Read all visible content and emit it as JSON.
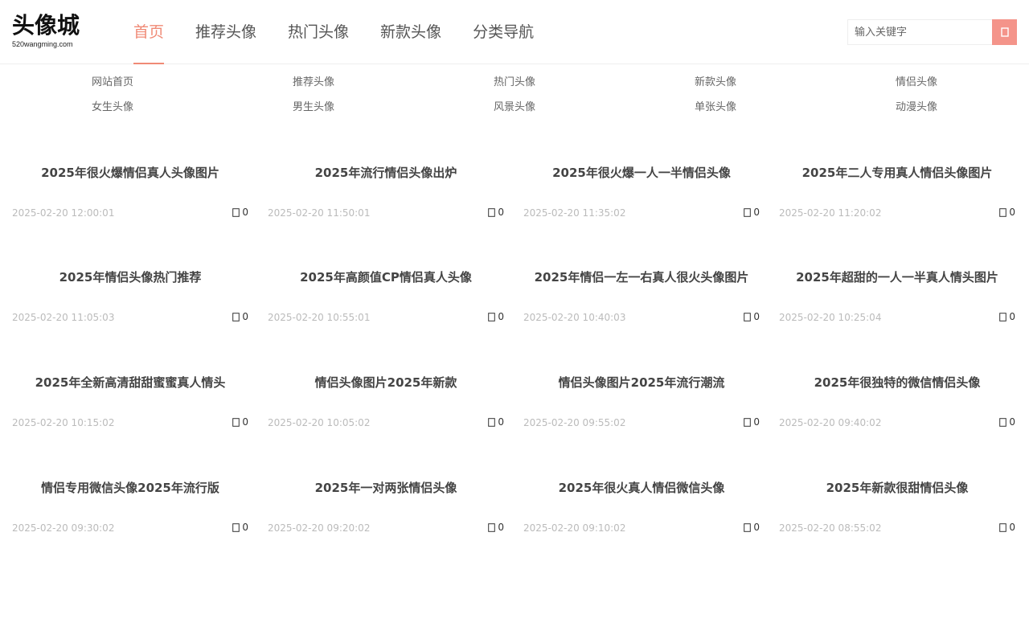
{
  "site": {
    "logo_title": "头像城",
    "logo_sub": "520wangming.com"
  },
  "nav": {
    "items": [
      {
        "label": "首页",
        "active": true
      },
      {
        "label": "推荐头像",
        "active": false
      },
      {
        "label": "热门头像",
        "active": false
      },
      {
        "label": "新款头像",
        "active": false
      },
      {
        "label": "分类导航",
        "active": false
      }
    ]
  },
  "search": {
    "placeholder": "输入关键字",
    "button_icon": "search-icon",
    "button_color": "#f4948a"
  },
  "subnav": {
    "rows": [
      [
        "网站首页",
        "推荐头像",
        "热门头像",
        "新款头像",
        "情侣头像"
      ],
      [
        "女生头像",
        "男生头像",
        "风景头像",
        "单张头像",
        "动漫头像"
      ]
    ]
  },
  "articles": [
    {
      "title": "2025年很火爆情侣真人头像图片",
      "date": "2025-02-20 12:00:01",
      "comments": "0"
    },
    {
      "title": "2025年流行情侣头像出炉",
      "date": "2025-02-20 11:50:01",
      "comments": "0"
    },
    {
      "title": "2025年很火爆一人一半情侣头像",
      "date": "2025-02-20 11:35:02",
      "comments": "0"
    },
    {
      "title": "2025年二人专用真人情侣头像图片",
      "date": "2025-02-20 11:20:02",
      "comments": "0"
    },
    {
      "title": "2025年情侣头像热门推荐",
      "date": "2025-02-20 11:05:03",
      "comments": "0"
    },
    {
      "title": "2025年高颜值CP情侣真人头像",
      "date": "2025-02-20 10:55:01",
      "comments": "0"
    },
    {
      "title": "2025年情侣一左一右真人很火头像图片",
      "date": "2025-02-20 10:40:03",
      "comments": "0"
    },
    {
      "title": "2025年超甜的一人一半真人情头图片",
      "date": "2025-02-20 10:25:04",
      "comments": "0"
    },
    {
      "title": "2025年全新高清甜甜蜜蜜真人情头",
      "date": "2025-02-20 10:15:02",
      "comments": "0"
    },
    {
      "title": "情侣头像图片2025年新款",
      "date": "2025-02-20 10:05:02",
      "comments": "0"
    },
    {
      "title": "情侣头像图片2025年流行潮流",
      "date": "2025-02-20 09:55:02",
      "comments": "0"
    },
    {
      "title": "2025年很独特的微信情侣头像",
      "date": "2025-02-20 09:40:02",
      "comments": "0"
    },
    {
      "title": "情侣专用微信头像2025年流行版",
      "date": "2025-02-20 09:30:02",
      "comments": "0"
    },
    {
      "title": "2025年一对两张情侣头像",
      "date": "2025-02-20 09:20:02",
      "comments": "0"
    },
    {
      "title": "2025年很火真人情侣微信头像",
      "date": "2025-02-20 09:10:02",
      "comments": "0"
    },
    {
      "title": "2025年新款很甜情侣头像",
      "date": "2025-02-20 08:55:02",
      "comments": "0"
    }
  ],
  "colors": {
    "accent": "#f08a76",
    "date_text": "#bbbbbb"
  }
}
